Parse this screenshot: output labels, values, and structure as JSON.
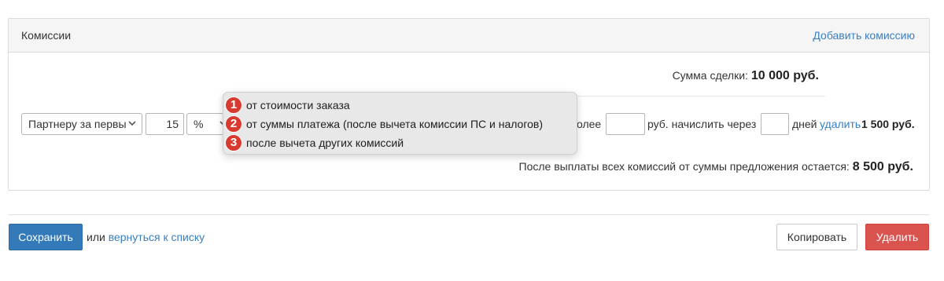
{
  "panel": {
    "title": "Комиссии",
    "add_link": "Добавить комиссию"
  },
  "deal": {
    "label": "Сумма сделки:",
    "amount": "10 000 руб."
  },
  "commission_row": {
    "recipient_select": "Партнеру за первы",
    "percent_value": "15",
    "unit_select": "%",
    "text_more": "олее",
    "more_value": "",
    "text_rub_after": "руб. начислить через",
    "days_value": "",
    "text_days": "дней",
    "delete_link": "удалить",
    "commission_amount": "1 500 руб."
  },
  "base_dropdown": {
    "options": [
      {
        "badge": "1",
        "label": "от стоимости заказа"
      },
      {
        "badge": "2",
        "label": "от суммы платежа (после вычета комиссии ПС и налогов)"
      },
      {
        "badge": "3",
        "label": "после вычета других комиссий"
      }
    ]
  },
  "remain": {
    "label": "После выплаты всех комиссий от суммы предложения остается:",
    "amount": "8 500 руб."
  },
  "footer": {
    "save_label": "Сохранить",
    "or_text": "или",
    "back_link": "вернуться к списку",
    "copy_label": "Копировать",
    "delete_label": "Удалить"
  },
  "colors": {
    "link": "#3a7fc1",
    "primary_button": "#347ab8",
    "danger_button": "#d9534f",
    "badge": "#d93a30"
  },
  "icons": {
    "select_arrow": "chevron-down-icon"
  }
}
